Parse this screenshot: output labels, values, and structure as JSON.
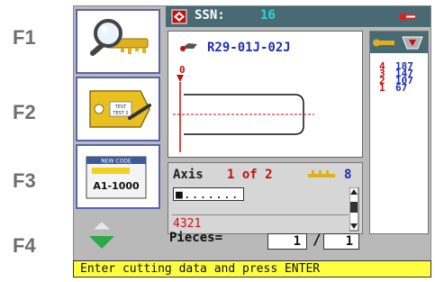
{
  "fkeys": {
    "f1": "F1",
    "f2": "F2",
    "f3": "F3",
    "f4": "F4"
  },
  "topbar": {
    "label": "SSN:",
    "value": "16"
  },
  "f3_card": {
    "title": "NEW CODE",
    "code": "A1-1000"
  },
  "f2_card": {
    "tag_text_1": "TEST",
    "tag_text_2": "TEST 2"
  },
  "main": {
    "key_reference": "R29-01J-02J",
    "cut_marker": "0"
  },
  "axis": {
    "label": "Axis",
    "current": "1 of 2",
    "number": "8",
    "input_value": "■.......",
    "code_value": "4321"
  },
  "right_panel": {
    "left_digits": [
      "4",
      "3",
      "2",
      "1"
    ],
    "right_values": [
      "187",
      "147",
      "107",
      "67"
    ]
  },
  "pieces": {
    "label": "Pieces=",
    "done": "1",
    "separator": "/",
    "total": "1"
  },
  "status": {
    "message": "Enter cutting data and press ENTER"
  },
  "colors": {
    "topbar": "#4a6a73",
    "accent_red": "#c01010",
    "accent_blue": "#1f2fb0",
    "status_bg": "#ffff40"
  }
}
